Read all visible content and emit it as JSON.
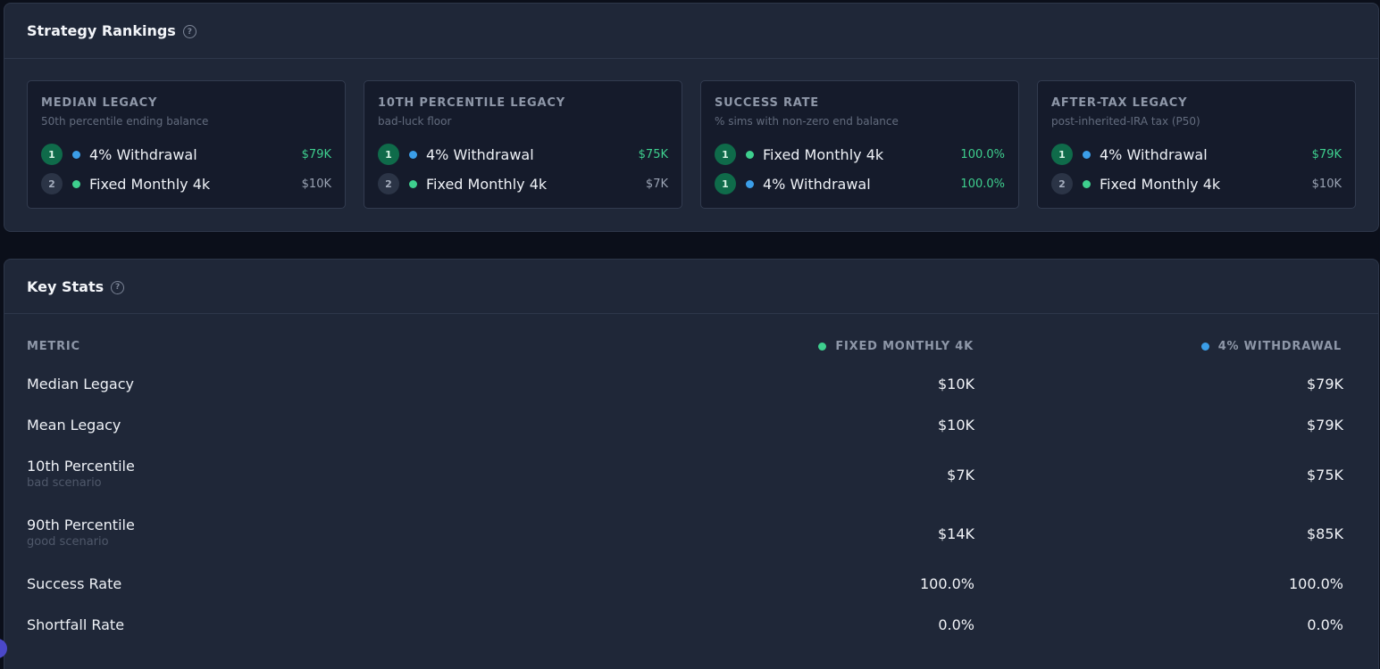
{
  "rankings": {
    "title": "Strategy Rankings",
    "help_icon": "?",
    "cards": [
      {
        "title": "MEDIAN LEGACY",
        "subtitle": "50th percentile ending balance",
        "rows": [
          {
            "rank": "1",
            "name": "4% Withdrawal",
            "value": "$79K",
            "dot_color": "#3b9ee8"
          },
          {
            "rank": "2",
            "name": "Fixed Monthly 4k",
            "value": "$10K",
            "dot_color": "#3ecf8e"
          }
        ]
      },
      {
        "title": "10TH PERCENTILE LEGACY",
        "subtitle": "bad-luck floor",
        "rows": [
          {
            "rank": "1",
            "name": "4% Withdrawal",
            "value": "$75K",
            "dot_color": "#3b9ee8"
          },
          {
            "rank": "2",
            "name": "Fixed Monthly 4k",
            "value": "$7K",
            "dot_color": "#3ecf8e"
          }
        ]
      },
      {
        "title": "SUCCESS RATE",
        "subtitle": "% sims with non-zero end balance",
        "rows": [
          {
            "rank": "1",
            "name": "Fixed Monthly 4k",
            "value": "100.0%",
            "dot_color": "#3ecf8e"
          },
          {
            "rank": "1",
            "name": "4% Withdrawal",
            "value": "100.0%",
            "dot_color": "#3b9ee8"
          }
        ]
      },
      {
        "title": "AFTER-TAX LEGACY",
        "subtitle": "post-inherited-IRA tax (P50)",
        "rows": [
          {
            "rank": "1",
            "name": "4% Withdrawal",
            "value": "$79K",
            "dot_color": "#3b9ee8"
          },
          {
            "rank": "2",
            "name": "Fixed Monthly 4k",
            "value": "$10K",
            "dot_color": "#3ecf8e"
          }
        ]
      }
    ]
  },
  "key_stats": {
    "title": "Key Stats",
    "help_icon": "?",
    "headers": {
      "metric": "METRIC",
      "col1": "FIXED MONTHLY 4K",
      "col2": "4% WITHDRAWAL"
    },
    "rows": [
      {
        "label": "Median Legacy",
        "sub": "",
        "v1": "$10K",
        "v2": "$79K"
      },
      {
        "label": "Mean Legacy",
        "sub": "",
        "v1": "$10K",
        "v2": "$79K"
      },
      {
        "label": "10th Percentile",
        "sub": "bad scenario",
        "v1": "$7K",
        "v2": "$75K"
      },
      {
        "label": "90th Percentile",
        "sub": "good scenario",
        "v1": "$14K",
        "v2": "$85K"
      },
      {
        "label": "Success Rate",
        "sub": "",
        "v1": "100.0%",
        "v2": "100.0%"
      },
      {
        "label": "Shortfall Rate",
        "sub": "",
        "v1": "0.0%",
        "v2": "0.0%"
      }
    ]
  },
  "colors": {
    "fixed_monthly": "#3ecf8e",
    "withdrawal_4pct": "#3b9ee8",
    "good_value": "#3ecf8e"
  }
}
